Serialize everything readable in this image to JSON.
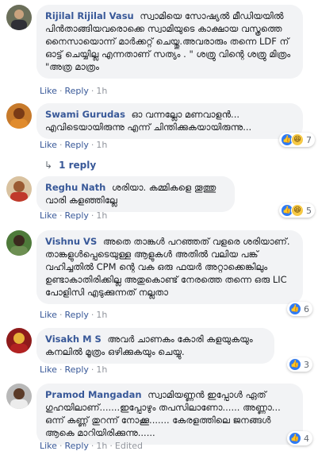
{
  "colors": {
    "link": "#385898",
    "bubble": "#f2f3f5",
    "like": "#2e7bf6",
    "haha": "#f7c945"
  },
  "common": {
    "like": "Like",
    "reply": "Reply",
    "dot": "·"
  },
  "comments": [
    {
      "author": "Rijilal Rijilal Vasu",
      "text": "സ്വാമിയെ സോഷ്യൽ മീഡിയയിൽ പിൻതാങ്ങിയവരൊക്കെ സ്വാമിയുടെ കാക്ഷായ വസ്ത്രത്തെ നൈസായൊന്ന് മാർക്കറ്റ് ചെയ്തു.അവരാരും തന്നെ LDF ന് ഓട്ട് ചെയ്യില്ല എന്നതാണ് സത്യം . \" ശത്രു വിന്റെ ശത്രു മിത്രം \"അത്ര മാത്രം",
      "time": "1h"
    },
    {
      "author": "Swami Gurudas",
      "text": "ഓ വന്നല്ലോ മണവാളൻ... എവിടെയായിരുന്നു എന്ന് ചിന്തിക്കുകയായിരുന്നു...",
      "time": "1h",
      "reactions": {
        "icons": [
          "like-icon",
          "haha-icon"
        ],
        "count": "7"
      },
      "replies_link": "1 reply"
    },
    {
      "author": "Reghu Nath",
      "text": "ശരിയാ. കമ്മികളെ തൂത്തു വാരി കളഞ്ഞില്ലേ",
      "time": "1h",
      "reactions": {
        "icons": [
          "like-icon",
          "haha-icon"
        ],
        "count": "5"
      }
    },
    {
      "author": "Vishnu VS",
      "text": "അതെ താങ്കൾ പറഞ്ഞത് വളരെ ശരിയാണ്. താങ്കളുൾപ്പെടെയുള്ള ആളുകൾ അതിൽ വലിയ പങ്ക് വഹിച്ചതിൽ CPM ന്റെ വക ഒരു ഫയർ അറ്റാക്കെങ്കിലും ഉണ്ടാകാതിരിക്കില്ല അതുകൊണ്ട് നേരത്തെ തന്നെ ഒരു LIC പോളിസി എടുക്കുന്നത് നല്ലതാ",
      "time": "1h",
      "reactions": {
        "icons": [
          "like-icon"
        ],
        "count": "6"
      }
    },
    {
      "author": "Visakh M S",
      "text": "അവർ ചാണകം കോരി കളയുകയും കനലിൽ മൂത്രം ഒഴിക്കുകയും ചെയ്യു.",
      "time": "1h",
      "reactions": {
        "icons": [
          "like-icon"
        ],
        "count": "3"
      }
    },
    {
      "author": "Pramod Mangadan",
      "text": "സ്വാമിയണ്ണൻ ഇപ്പോൾ ഏത് ഗുഹയിലാണ്.......ഇപ്പോഴും തപസിലാണോ...... അണ്ണാ... ഒന്ന് കണ്ണ് തുറന്ന് നോക്കൂ....... കേരളത്തിലെ ജനങ്ങൾ ആകെ മാറിയിരിക്കുന്നു......",
      "time": "1h",
      "edited": "Edited",
      "reactions": {
        "icons": [
          "like-icon"
        ],
        "count": "4"
      }
    }
  ]
}
